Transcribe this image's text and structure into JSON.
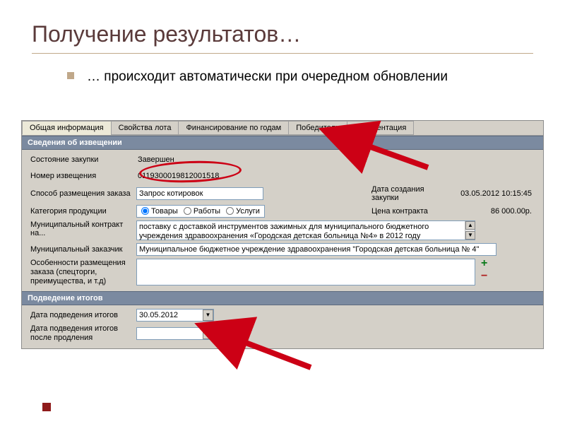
{
  "slide": {
    "title": "Получение результатов…",
    "bullet": "… происходит автоматически при очередном обновлении"
  },
  "tabs": {
    "t1": "Общая информация",
    "t2": "Свойства лота",
    "t3": "Финансирование по годам",
    "t4": "Победители",
    "t5": "Документация"
  },
  "sections": {
    "info_header": "Сведения об извещении",
    "results_header": "Подведение итогов"
  },
  "labels": {
    "status": "Состояние закупки",
    "notice_num": "Номер извещения",
    "method": "Способ размещения заказа",
    "category": "Категория продукции",
    "contract_for": "Муниципальный контракт на...",
    "customer": "Муниципальный заказчик",
    "features": "Особенности размещения заказа (спецторги, преимущества, и т.д)",
    "create_date": "Дата создания закупки",
    "contract_price": "Цена контракта",
    "result_date": "Дата подведения итогов",
    "result_date_ext": "Дата подведения итогов после продления"
  },
  "values": {
    "status": "Завершен",
    "notice_num": "0119300019812001518",
    "method": "Запрос котировок",
    "radio_goods": "Товары",
    "radio_works": "Работы",
    "radio_services": "Услуги",
    "create_date": "03.05.2012 10:15:45",
    "contract_price": "86 000.00р.",
    "contract_desc": "поставку с доставкой инструментов зажимных для муниципального бюджетного учреждения здравоохранения «Городская детская больница №4» в 2012 году",
    "customer": "Муниципальное бюджетное учреждение здравоохранения \"Городская детская больница № 4\"",
    "result_date": "30.05.2012"
  },
  "icons": {
    "plus": "+",
    "minus": "−",
    "dropdown": "▼",
    "scroll_up": "▲",
    "scroll_down": "▼"
  }
}
